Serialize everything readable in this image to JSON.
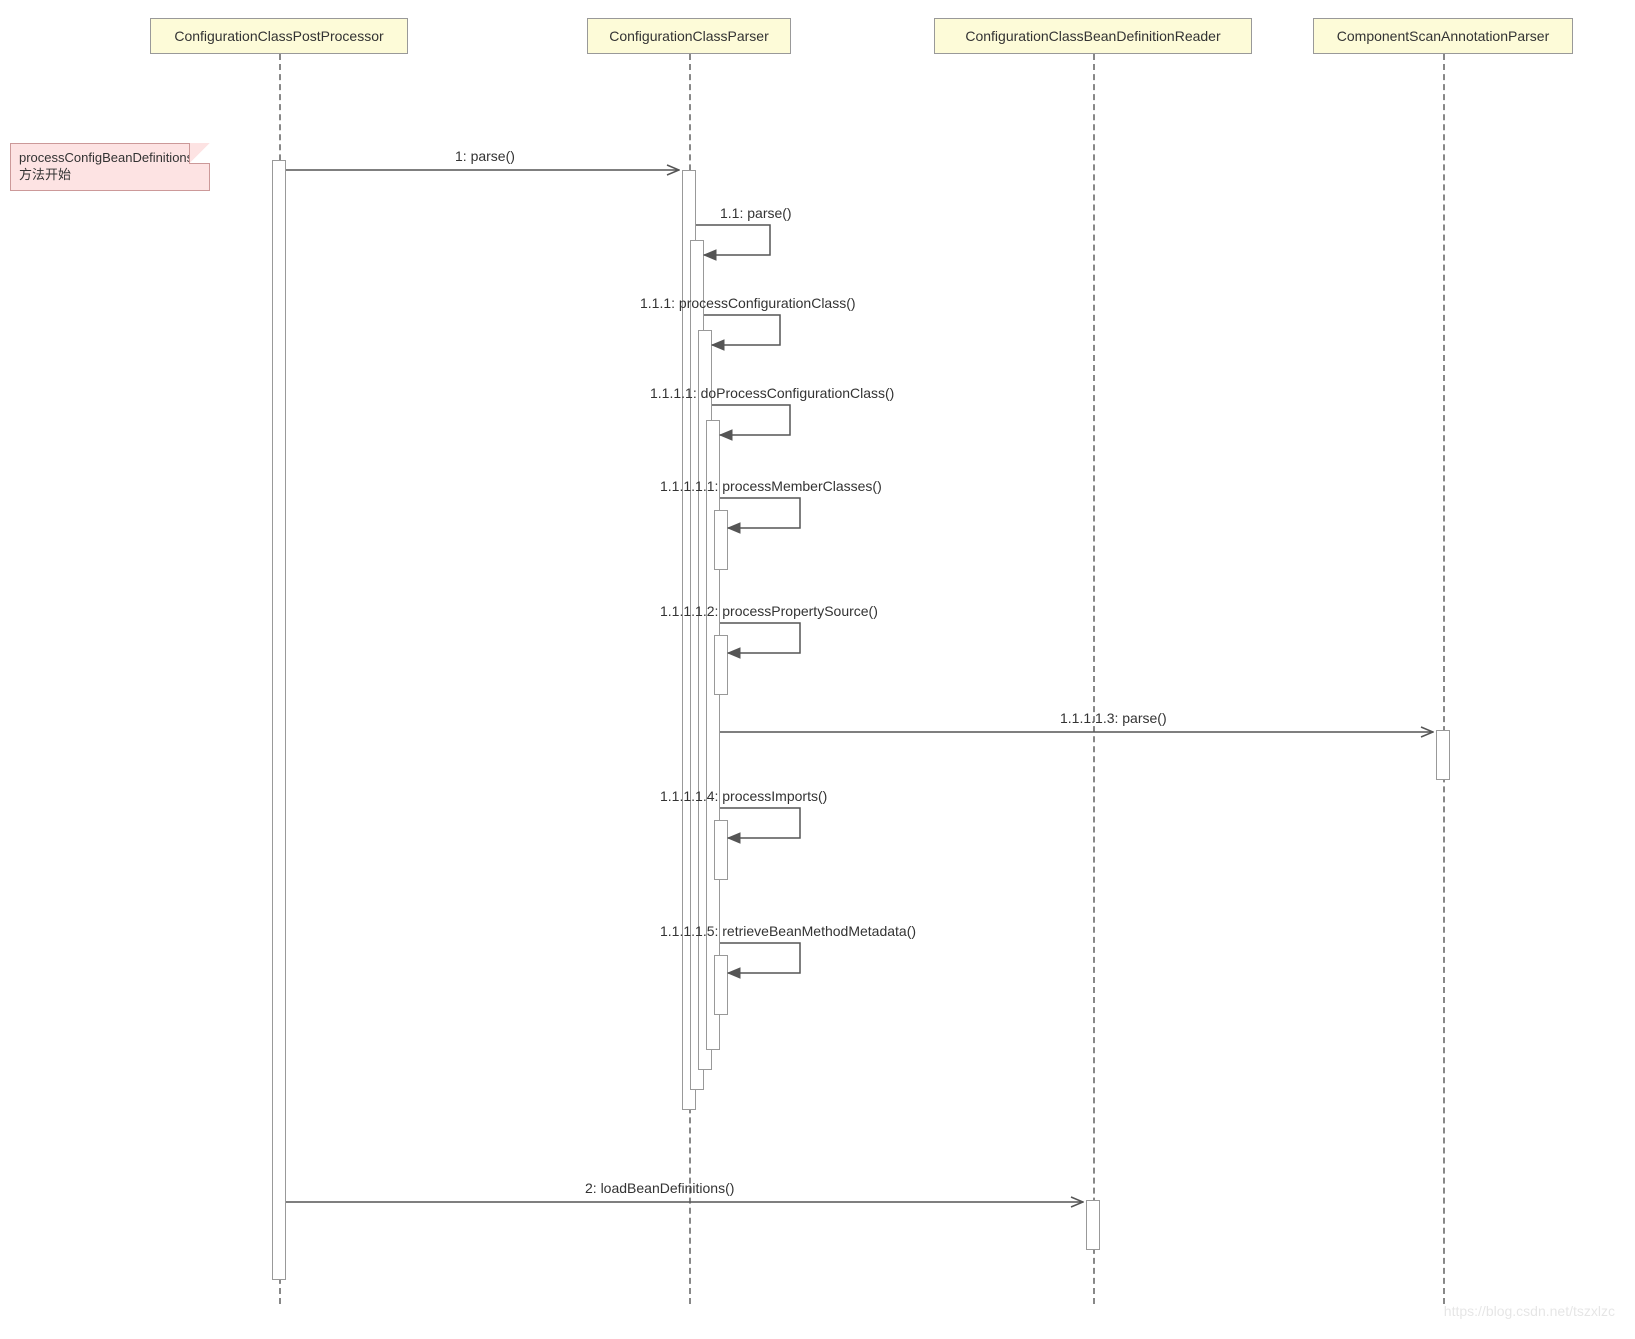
{
  "participants": {
    "p1": "ConfigurationClassPostProcessor",
    "p2": "ConfigurationClassParser",
    "p3": "ConfigurationClassBeanDefinitionReader",
    "p4": "ComponentScanAnnotationParser"
  },
  "note": {
    "text": "processConfigBeanDefinitions方法开始"
  },
  "messages": {
    "m1": "1: parse()",
    "m11": "1.1: parse()",
    "m111": "1.1.1: processConfigurationClass()",
    "m1111": "1.1.1.1: doProcessConfigurationClass()",
    "m11111": "1.1.1.1.1: processMemberClasses()",
    "m11112": "1.1.1.1.2: processPropertySource()",
    "m11113": "1.1.1.1.3: parse()",
    "m11114": "1.1.1.1.4: processImports()",
    "m11115": "1.1.1.1.5: retrieveBeanMethodMetadata()",
    "m2": "2: loadBeanDefinitions()"
  },
  "watermark": "https://blog.csdn.net/tszxlzc"
}
